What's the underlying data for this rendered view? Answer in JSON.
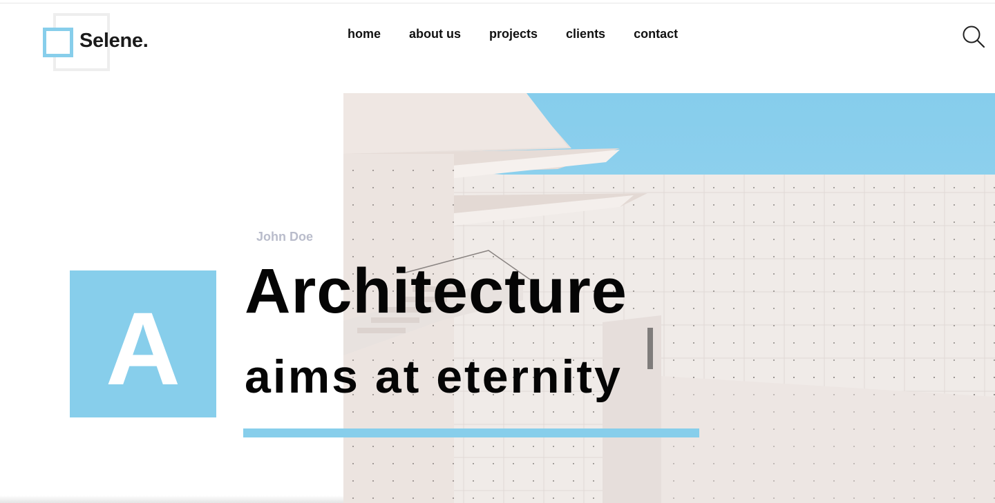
{
  "brand": {
    "name": "Selene."
  },
  "nav": {
    "items": [
      {
        "label": "home"
      },
      {
        "label": "about us"
      },
      {
        "label": "projects"
      },
      {
        "label": "clients"
      },
      {
        "label": "contact"
      }
    ],
    "search_icon": "search-icon"
  },
  "hero": {
    "author": "John Doe",
    "letter": "A",
    "title_line1": "Architecture",
    "title_line2": "aims at eternity",
    "image": "white-concrete-building-blue-sky"
  },
  "colors": {
    "accent": "#87ceeb",
    "text": "#050505",
    "muted": "#b9bccb"
  }
}
